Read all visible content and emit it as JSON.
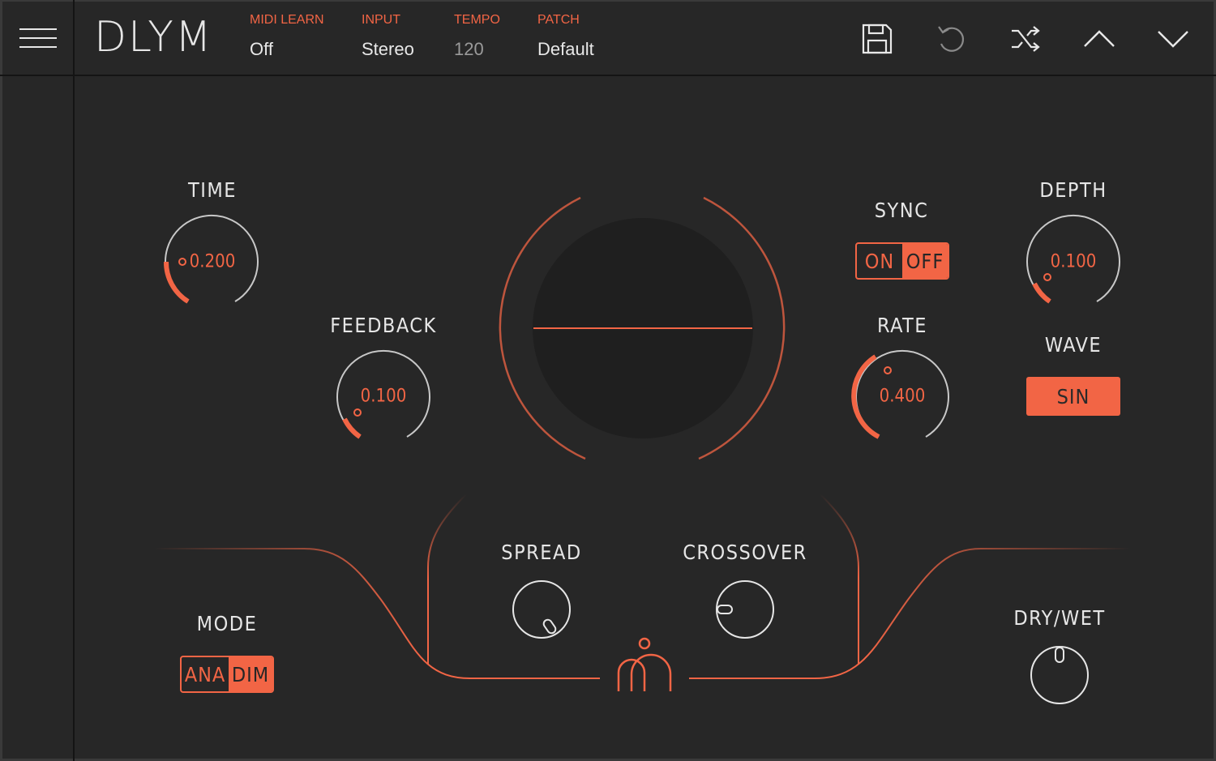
{
  "header": {
    "brand": "DLYM",
    "midi_learn": {
      "label": "MIDI LEARN",
      "value": "Off"
    },
    "input": {
      "label": "INPUT",
      "value": "Stereo"
    },
    "tempo": {
      "label": "TEMPO",
      "value": "120"
    },
    "patch": {
      "label": "PATCH",
      "value": "Default"
    }
  },
  "toolbar": {
    "icons": [
      "save-icon",
      "undo-icon",
      "shuffle-icon",
      "chevron-up-icon",
      "chevron-down-icon"
    ]
  },
  "controls": {
    "time": {
      "label": "TIME",
      "value": "0.200"
    },
    "feedback": {
      "label": "FEEDBACK",
      "value": "0.100"
    },
    "sync": {
      "label": "SYNC",
      "on": "ON",
      "off": "OFF",
      "selected": "OFF"
    },
    "rate": {
      "label": "RATE",
      "value": "0.400"
    },
    "depth": {
      "label": "DEPTH",
      "value": "0.100"
    },
    "wave": {
      "label": "WAVE",
      "value": "SIN"
    },
    "spread": {
      "label": "SPREAD"
    },
    "crossover": {
      "label": "CROSSOVER"
    },
    "mode": {
      "label": "MODE",
      "a": "ANA",
      "b": "DIM",
      "selected": "DIM"
    },
    "dry_wet": {
      "label": "DRY/WET"
    }
  },
  "colors": {
    "accent": "#f26545",
    "background": "#272727",
    "text": "#e6e6e6"
  }
}
